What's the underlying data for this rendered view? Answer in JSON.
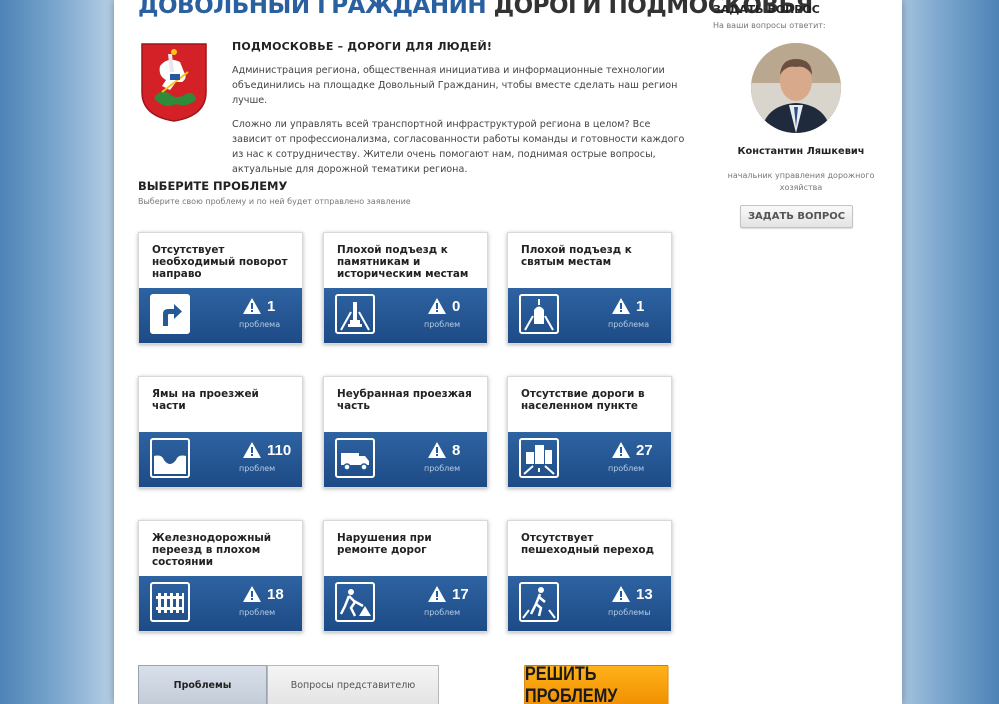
{
  "header": {
    "title_blue": "ДОВОЛЬНЫЙ ГРАЖДАНИН",
    "title_dark": "ДОРОГИ ПОДМОСКОВЬЯ"
  },
  "intro": {
    "heading": "ПОДМОСКОВЬЕ – ДОРОГИ ДЛЯ ЛЮДЕЙ!",
    "paragraph_1": "Администрация региона, общественная инициатива и информационные технологии объединились на площадке Довольный Гражданин, чтобы вместе сделать наш регион лучше.",
    "paragraph_2": "Сложно ли управлять всей транспортной инфраструктурой региона в целом? Все зависит от профессионализма, согласованности работы команды и готовности каждого из нас к сотрудничеству. Жители очень помогают нам, поднимая острые вопросы, актуальные для дорожной тематики региона."
  },
  "choose": {
    "title": "ВЫБЕРИТЕ ПРОБЛЕМУ",
    "subtitle": "Выберите свою проблему и по ней будет отправлено заявление"
  },
  "tiles": [
    {
      "title": "Отсутствует необходимый поворот направо",
      "count": "1",
      "unit": "проблема",
      "icon": "turn-right-icon"
    },
    {
      "title": "Плохой подъезд к памятникам и историческим местам",
      "count": "0",
      "unit": "проблем",
      "icon": "monument-icon"
    },
    {
      "title": "Плохой подъезд к святым местам",
      "count": "1",
      "unit": "проблема",
      "icon": "church-icon"
    },
    {
      "title": "Ямы на проезжей части",
      "count": "110",
      "unit": "проблем",
      "icon": "pothole-icon"
    },
    {
      "title": "Неубранная проезжая часть",
      "count": "8",
      "unit": "проблем",
      "icon": "truck-icon"
    },
    {
      "title": "Отсутствие дороги в населенном пункте",
      "count": "27",
      "unit": "проблем",
      "icon": "buildings-road-icon"
    },
    {
      "title": "Железнодорожный переезд в плохом состоянии",
      "count": "18",
      "unit": "проблем",
      "icon": "railway-crossing-icon"
    },
    {
      "title": "Нарушения при ремонте дорог",
      "count": "17",
      "unit": "проблем",
      "icon": "road-works-icon"
    },
    {
      "title": "Отсутствует пешеходный переход",
      "count": "13",
      "unit": "проблемы",
      "icon": "pedestrian-crossing-icon"
    }
  ],
  "tabs": {
    "problems": "Проблемы",
    "questions": "Вопросы представителю"
  },
  "solve_button": "РЕШИТЬ ПРОБЛЕМУ",
  "sidebar": {
    "title": "ЗАДАТЬ ВОПРОС",
    "subtitle": "На ваши вопросы ответит:",
    "name": "Константин Ляшкевич",
    "role": "начальник управления дорожного хозяйства",
    "ask_button": "ЗАДАТЬ ВОПРОС"
  },
  "colors": {
    "tile_blue": "#245a96",
    "title_blue": "#2a5fa0",
    "button_orange": "#f5a000"
  }
}
